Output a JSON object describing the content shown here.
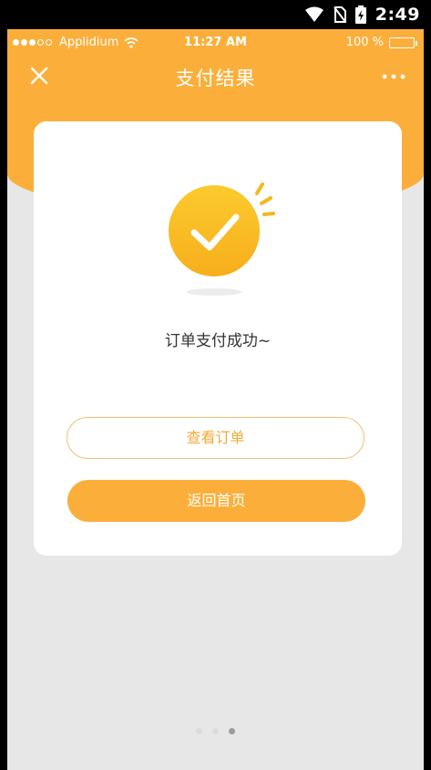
{
  "android_status": {
    "time": "2:49"
  },
  "ios_status": {
    "carrier": "Applidium",
    "time": "11:27 AM",
    "battery": "100 %"
  },
  "navbar": {
    "title": "支付结果"
  },
  "result": {
    "message": "订单支付成功~"
  },
  "buttons": {
    "view_order": "查看订单",
    "back_home": "返回首页"
  },
  "pager": {
    "count": 3,
    "active_index": 2
  },
  "colors": {
    "accent": "#fbaf3a",
    "background": "#e7e7e7",
    "outline": "#f2c27a"
  }
}
